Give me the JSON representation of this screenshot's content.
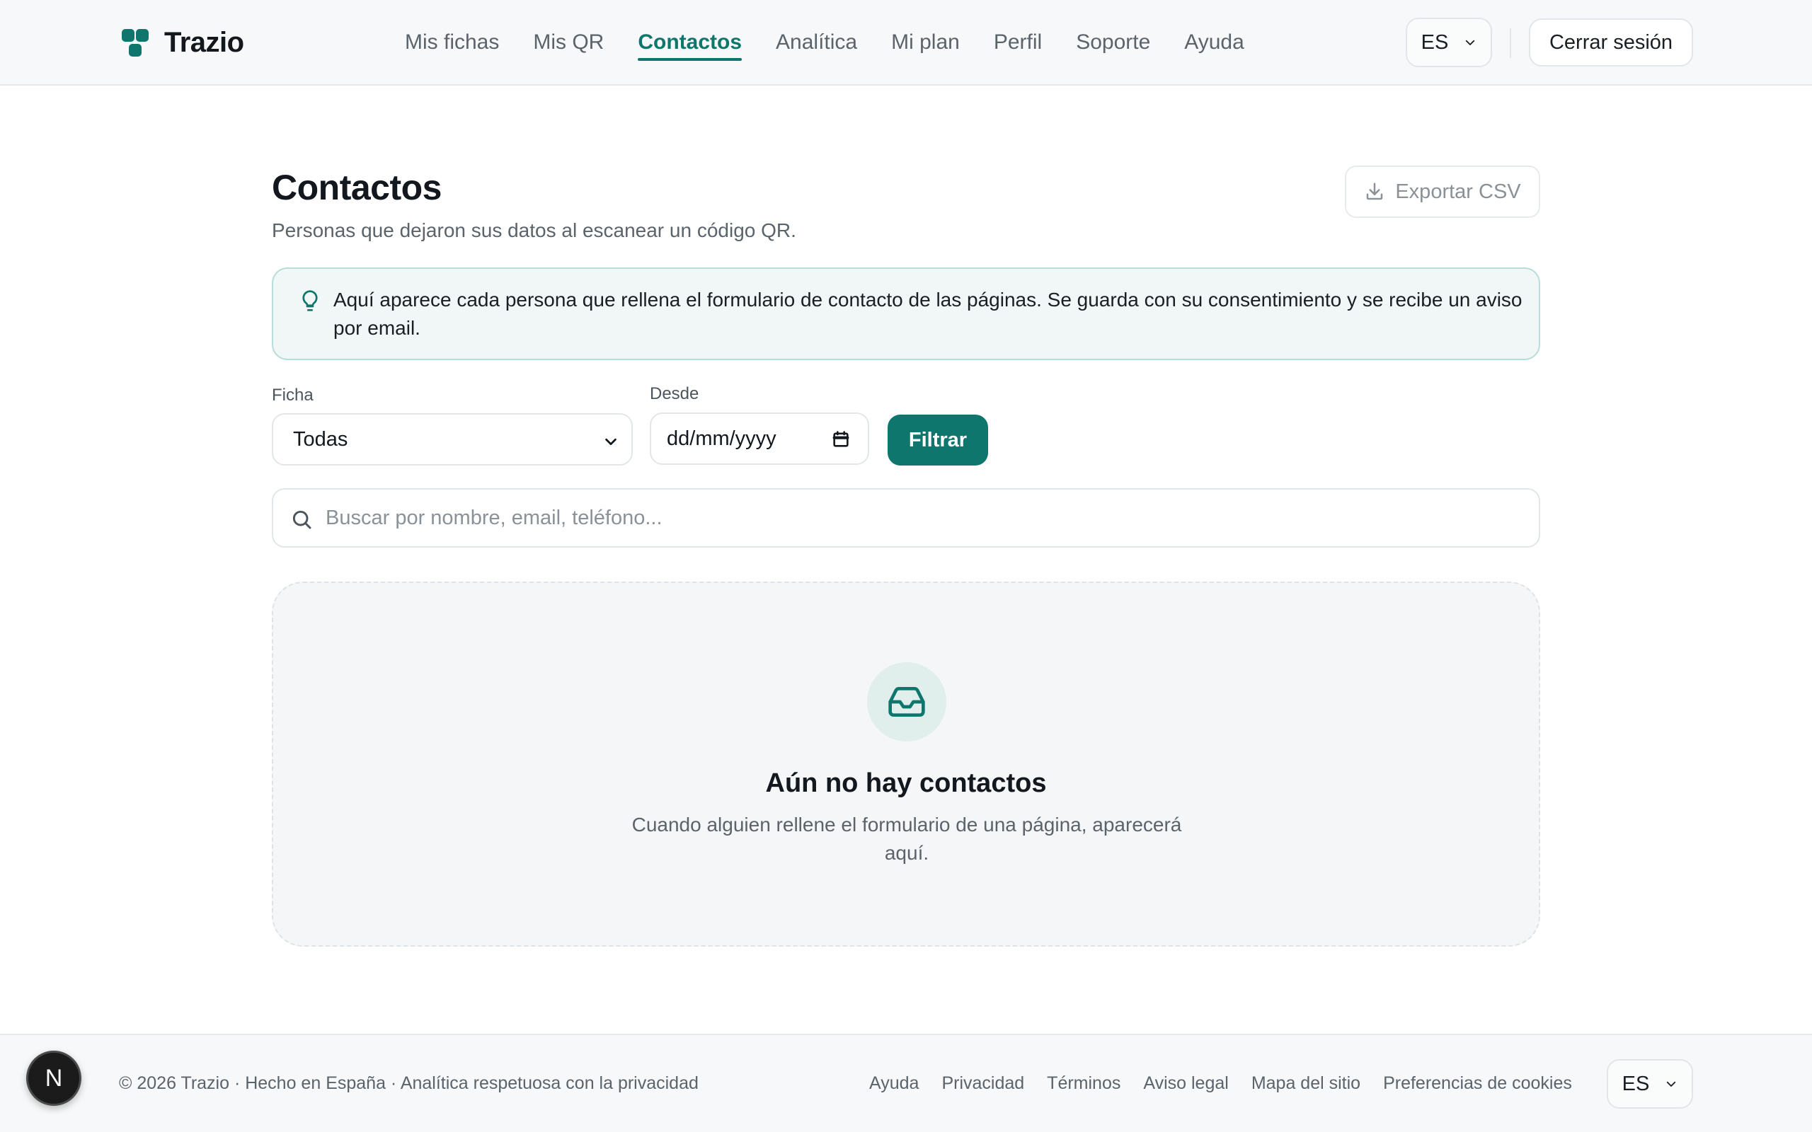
{
  "header": {
    "brand": "Trazio",
    "nav": [
      {
        "label": "Mis fichas",
        "active": false
      },
      {
        "label": "Mis QR",
        "active": false
      },
      {
        "label": "Contactos",
        "active": true
      },
      {
        "label": "Analítica",
        "active": false
      },
      {
        "label": "Mi plan",
        "active": false
      },
      {
        "label": "Perfil",
        "active": false
      },
      {
        "label": "Soporte",
        "active": false
      },
      {
        "label": "Ayuda",
        "active": false
      }
    ],
    "language": "ES",
    "logout_label": "Cerrar sesión"
  },
  "main": {
    "title": "Contactos",
    "subtitle": "Personas que dejaron sus datos al escanear un código QR.",
    "export_label": "Exportar CSV",
    "info_text": "Aquí aparece cada persona que rellena el formulario de contacto de las páginas. Se guarda con su consentimiento y se recibe un aviso por email.",
    "filters": {
      "ficha_label": "Ficha",
      "ficha_value": "Todas",
      "desde_label": "Desde",
      "desde_placeholder": "dd/mm/yyyy",
      "filter_button": "Filtrar"
    },
    "search": {
      "placeholder": "Buscar por nombre, email, teléfono..."
    },
    "empty_state": {
      "title": "Aún no hay contactos",
      "text": "Cuando alguien rellene el formulario de una página, aparecerá aquí."
    }
  },
  "footer": {
    "copyright": "© 2026 Trazio · Hecho en España · Analítica respetuosa con la privacidad",
    "links": [
      "Ayuda",
      "Privacidad",
      "Términos",
      "Aviso legal",
      "Mapa del sitio",
      "Preferencias de cookies"
    ],
    "language": "ES"
  },
  "dev_badge": "N",
  "colors": {
    "accent": "#0f766e",
    "info_bg": "#f0f7f6",
    "info_border": "#b7ddd8"
  },
  "icons": {
    "logo": "trazio-logo-icon",
    "export": "download-icon",
    "info": "lightbulb-icon",
    "search": "search-icon",
    "empty": "inbox-icon",
    "calendar": "calendar-icon",
    "chevron": "chevron-down-icon"
  }
}
